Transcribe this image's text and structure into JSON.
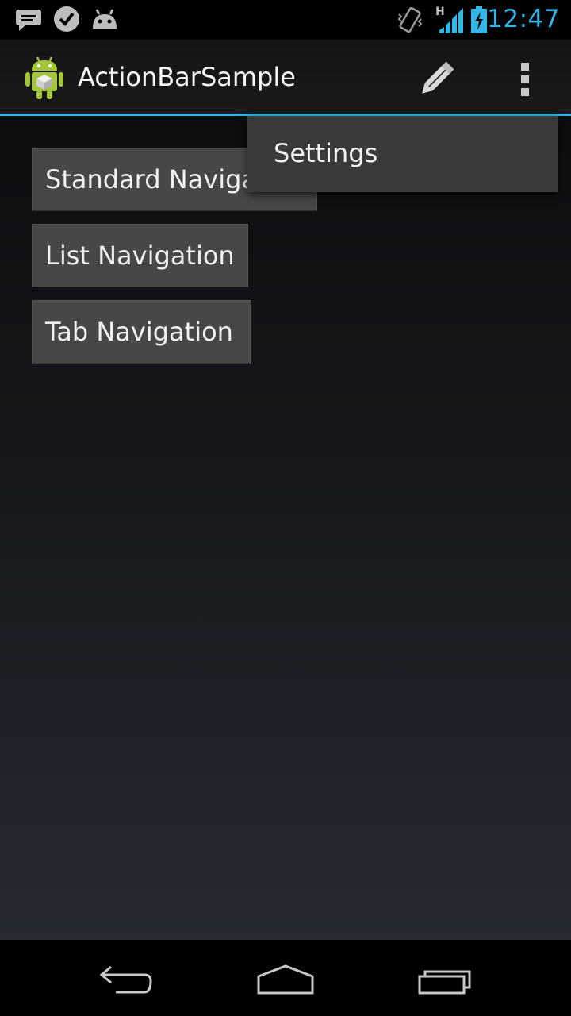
{
  "status_bar": {
    "time": "12:47",
    "network": "H",
    "icons": [
      "chat-notification-icon",
      "task-check-icon",
      "android-debug-icon",
      "vibrate-icon",
      "signal-icon",
      "battery-charging-icon"
    ],
    "accent_color": "#33b5e5"
  },
  "action_bar": {
    "title": "ActionBarSample",
    "icons": [
      "android-app-icon",
      "pencil-edit-icon",
      "overflow-menu-icon"
    ]
  },
  "main": {
    "buttons": [
      {
        "label": "Standard Navigation"
      },
      {
        "label": "List Navigation"
      },
      {
        "label": "Tab Navigation"
      }
    ]
  },
  "overflow_menu": {
    "items": [
      {
        "label": "Settings"
      }
    ]
  },
  "nav_bar": {
    "icons": [
      "back-icon",
      "home-icon",
      "recent-apps-icon"
    ]
  }
}
